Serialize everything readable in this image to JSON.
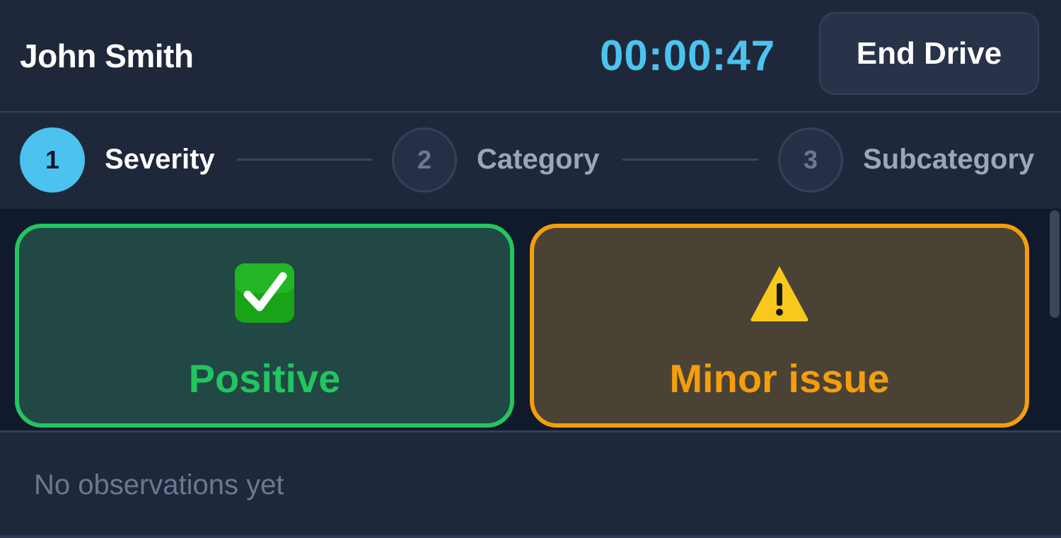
{
  "header": {
    "driver_name": "John Smith",
    "timer": "00:00:47",
    "end_drive_label": "End Drive"
  },
  "stepper": {
    "steps": [
      {
        "number": "1",
        "label": "Severity",
        "state": "active"
      },
      {
        "number": "2",
        "label": "Category",
        "state": "inactive"
      },
      {
        "number": "3",
        "label": "Subcategory",
        "state": "inactive"
      }
    ]
  },
  "options": [
    {
      "label": "Positive",
      "icon": "check-mark-icon",
      "color": "#22c55e"
    },
    {
      "label": "Minor issue",
      "icon": "warning-icon",
      "color": "#f59e0b"
    }
  ],
  "observations": {
    "empty_text": "No observations yet"
  },
  "colors": {
    "accent": "#4cc3ef",
    "background": "#1f283a",
    "panel": "#111a2c"
  }
}
